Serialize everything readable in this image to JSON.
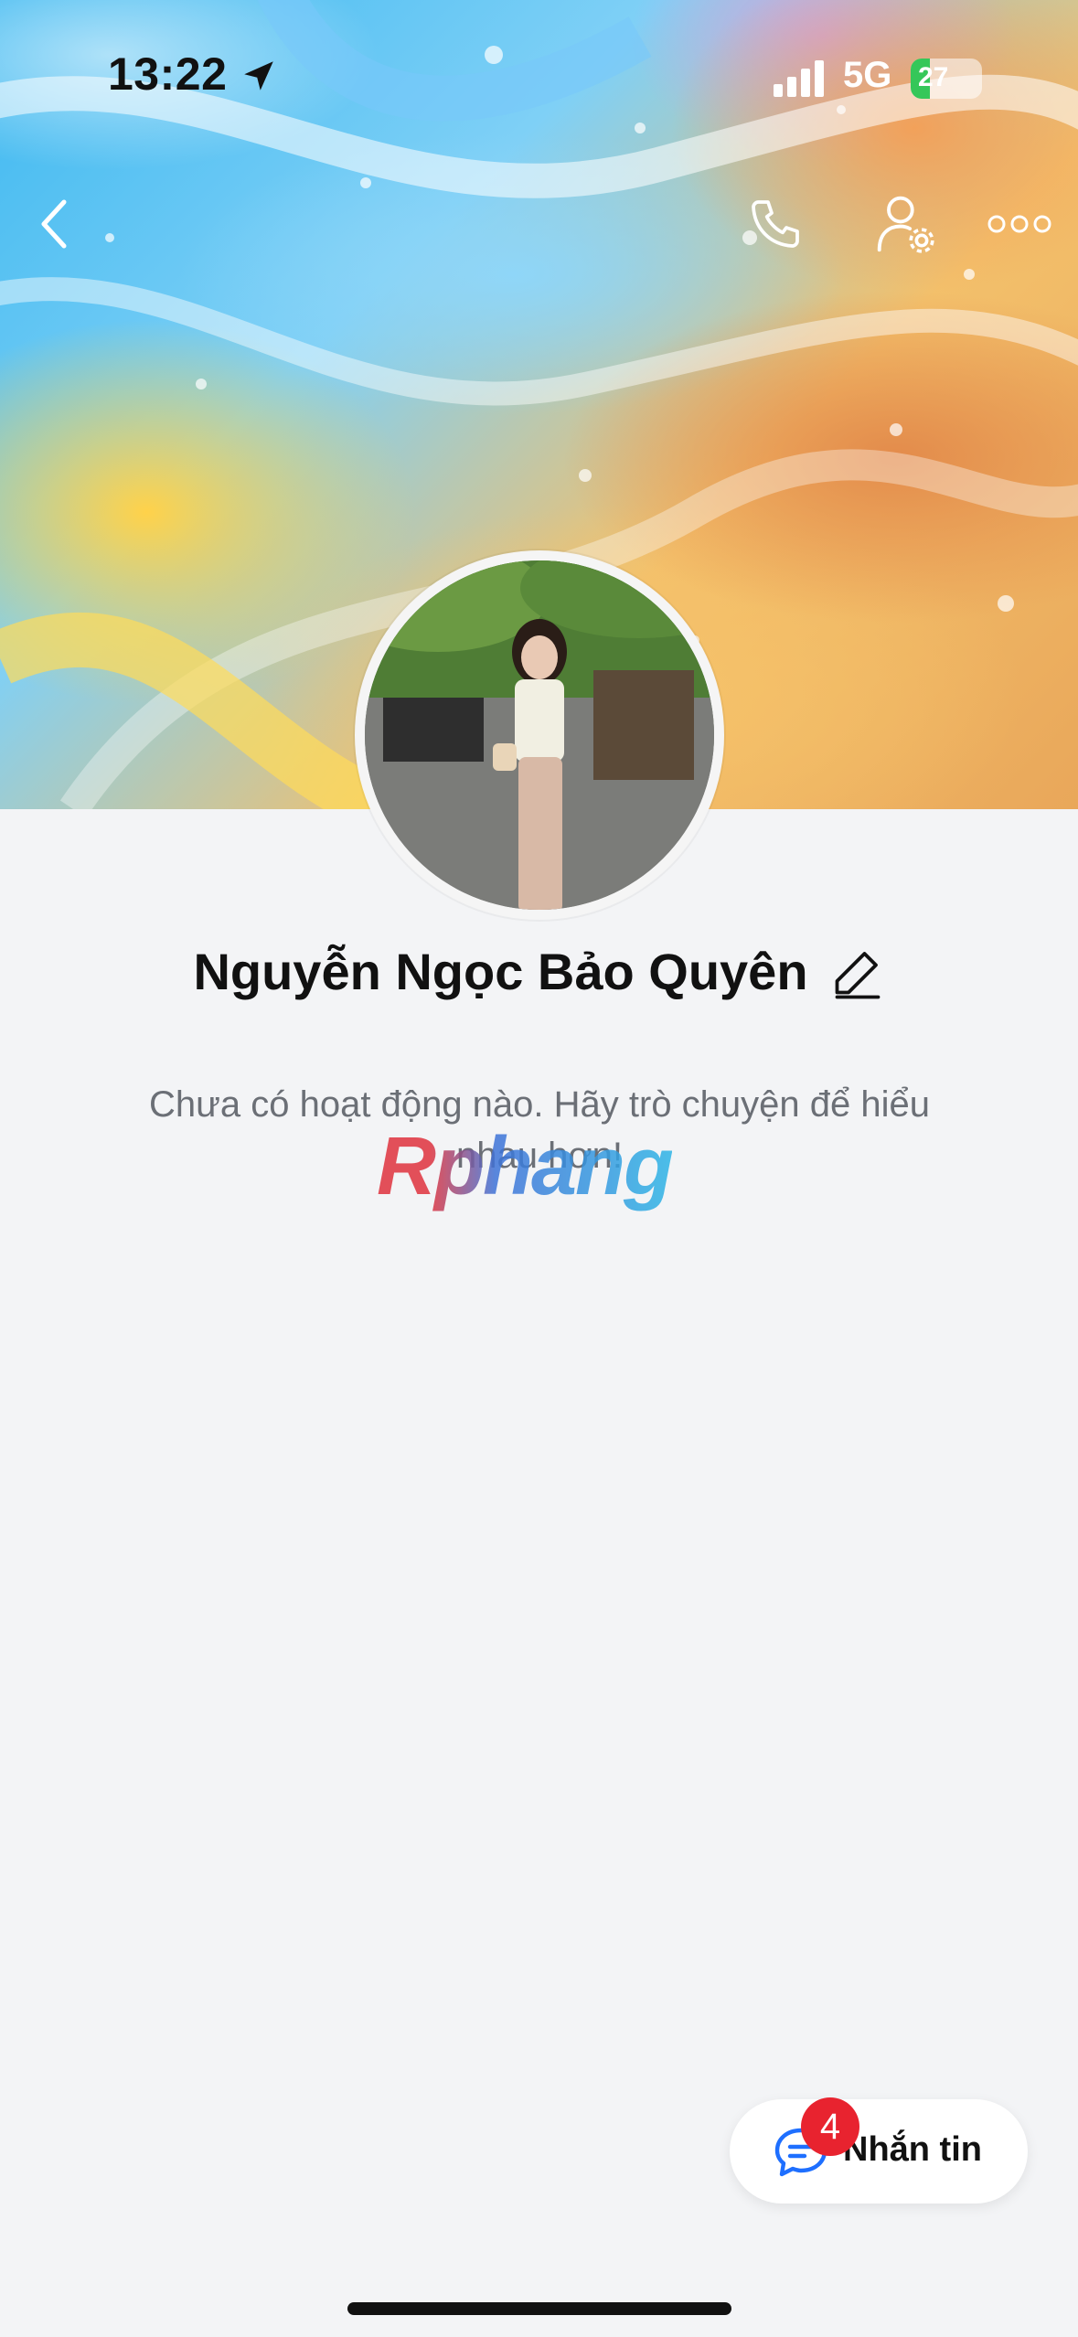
{
  "status_bar": {
    "time": "13:22",
    "network": "5G",
    "battery_percent": "27",
    "battery_level": 0.27
  },
  "profile": {
    "name": "Nguyễn Ngọc Bảo Quyên",
    "empty_message": "Chưa có hoạt động nào. Hãy trò chuyện để hiểu nhau hơn!"
  },
  "watermark": "Rphang",
  "message_button": {
    "label": "Nhắn tin",
    "badge_count": "4"
  },
  "colors": {
    "badge": "#e8232f",
    "chat_icon": "#1e6fff",
    "background": "#f3f4f6"
  },
  "icons": [
    "back-icon",
    "phone-icon",
    "person-settings-icon",
    "more-icon",
    "edit-icon",
    "chat-icon",
    "location-arrow-icon",
    "signal-icon"
  ]
}
